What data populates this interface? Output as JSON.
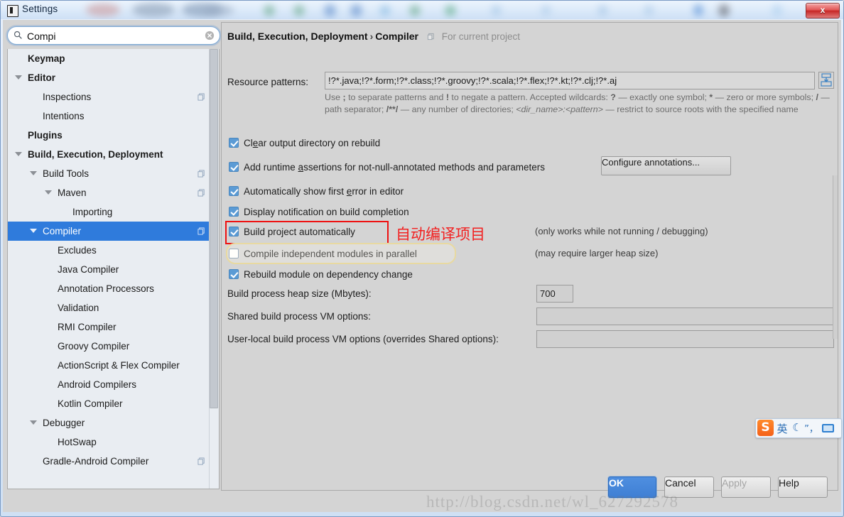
{
  "window": {
    "title": "Settings",
    "icon": "intellij-idea-icon",
    "close_label": "x"
  },
  "search": {
    "value": "Compi",
    "placeholder": "",
    "icon": "search-icon",
    "clear_icon": "clear-circle-icon"
  },
  "sidebar": {
    "items": [
      {
        "label": "Keymap",
        "indent": 0,
        "bold": true,
        "arrow": "none",
        "selected": false,
        "copy": false
      },
      {
        "label": "Editor",
        "indent": 0,
        "bold": true,
        "arrow": "expanded",
        "selected": false,
        "copy": false
      },
      {
        "label": "Inspections",
        "indent": 1,
        "bold": false,
        "arrow": "none",
        "selected": false,
        "copy": true
      },
      {
        "label": "Intentions",
        "indent": 1,
        "bold": false,
        "arrow": "none",
        "selected": false,
        "copy": false
      },
      {
        "label": "Plugins",
        "indent": 0,
        "bold": true,
        "arrow": "none",
        "selected": false,
        "copy": false
      },
      {
        "label": "Build, Execution, Deployment",
        "indent": 0,
        "bold": true,
        "arrow": "expanded",
        "selected": false,
        "copy": false
      },
      {
        "label": "Build Tools",
        "indent": 1,
        "bold": false,
        "arrow": "expanded",
        "selected": false,
        "copy": true
      },
      {
        "label": "Maven",
        "indent": 2,
        "bold": false,
        "arrow": "expanded",
        "selected": false,
        "copy": true
      },
      {
        "label": "Importing",
        "indent": 3,
        "bold": false,
        "arrow": "none",
        "selected": false,
        "copy": false
      },
      {
        "label": "Compiler",
        "indent": 1,
        "bold": false,
        "arrow": "expanded",
        "selected": true,
        "copy": true
      },
      {
        "label": "Excludes",
        "indent": 2,
        "bold": false,
        "arrow": "none",
        "selected": false,
        "copy": false
      },
      {
        "label": "Java Compiler",
        "indent": 2,
        "bold": false,
        "arrow": "none",
        "selected": false,
        "copy": false
      },
      {
        "label": "Annotation Processors",
        "indent": 2,
        "bold": false,
        "arrow": "none",
        "selected": false,
        "copy": false
      },
      {
        "label": "Validation",
        "indent": 2,
        "bold": false,
        "arrow": "none",
        "selected": false,
        "copy": false
      },
      {
        "label": "RMI Compiler",
        "indent": 2,
        "bold": false,
        "arrow": "none",
        "selected": false,
        "copy": false
      },
      {
        "label": "Groovy Compiler",
        "indent": 2,
        "bold": false,
        "arrow": "none",
        "selected": false,
        "copy": false
      },
      {
        "label": "ActionScript & Flex Compiler",
        "indent": 2,
        "bold": false,
        "arrow": "none",
        "selected": false,
        "copy": false
      },
      {
        "label": "Android Compilers",
        "indent": 2,
        "bold": false,
        "arrow": "none",
        "selected": false,
        "copy": false
      },
      {
        "label": "Kotlin Compiler",
        "indent": 2,
        "bold": false,
        "arrow": "none",
        "selected": false,
        "copy": false
      },
      {
        "label": "Debugger",
        "indent": 1,
        "bold": false,
        "arrow": "expanded",
        "selected": false,
        "copy": false
      },
      {
        "label": "HotSwap",
        "indent": 2,
        "bold": false,
        "arrow": "none",
        "selected": false,
        "copy": false
      },
      {
        "label": "Gradle-Android Compiler",
        "indent": 1,
        "bold": false,
        "arrow": "none",
        "selected": false,
        "copy": true
      }
    ]
  },
  "breadcrumb": {
    "part1": "Build, Execution, Deployment",
    "separator": "›",
    "part2": "Compiler",
    "scope": "For current project"
  },
  "form": {
    "resource_patterns_label": "Resource patterns:",
    "resource_patterns_value": "!?*.java;!?*.form;!?*.class;!?*.groovy;!?*.scala;!?*.flex;!?*.kt;!?*.clj;!?*.aj",
    "expand_button_icon": "expand-into-box-icon",
    "help_line1_a": "Use ",
    "help_line1_b": ";",
    "help_line1_c": " to separate patterns and ",
    "help_line1_d": "!",
    "help_line1_e": " to negate a pattern. Accepted wildcards: ",
    "help_line1_f": "?",
    "help_line1_g": " — exactly one symbol; ",
    "help_line1_h": "*",
    "help_line1_i": " — zero or more symbols; ",
    "help_line1_j": "/",
    "help_line1_k": " — path separator; ",
    "help_line1_l": "/**/",
    "help_line1_m": " — any number of directories; ",
    "help_line1_n": "<dir_name>:<pattern>",
    "help_line1_o": " — restrict to source roots with the specified name",
    "heap_label": "Build process heap size (Mbytes):",
    "heap_value": "700",
    "shared_vm_label": "Shared build process VM options:",
    "shared_vm_value": "",
    "userlocal_vm_label": "User-local build process VM options (overrides Shared options):",
    "userlocal_vm_value": ""
  },
  "checkboxes": [
    {
      "label_pre": "Cl",
      "mnemonic": "e",
      "label_post": "ar output directory on rebuild",
      "checked": true
    },
    {
      "label_pre": "Add runtime ",
      "mnemonic": "a",
      "label_post": "ssertions for not-null-annotated methods and parameters",
      "checked": true
    },
    {
      "label_pre": "Automatically show first ",
      "mnemonic": "e",
      "label_post": "rror in editor",
      "checked": true
    },
    {
      "label_pre": "Display notification on build completion",
      "mnemonic": "",
      "label_post": "",
      "checked": true
    },
    {
      "label_pre": "Build project automatically",
      "mnemonic": "",
      "label_post": "",
      "checked": true
    },
    {
      "label_pre": "Compile independent modules in parallel",
      "mnemonic": "",
      "label_post": "",
      "checked": false
    },
    {
      "label_pre": "Rebuild module on dependency change",
      "mnemonic": "",
      "label_post": "",
      "checked": true
    }
  ],
  "hints": {
    "not_running": "(only works while not running / debugging)",
    "heap_size": "(may require larger heap size)"
  },
  "buttons": {
    "configure_annotations": "Configure annotations...",
    "ok": "OK",
    "cancel": "Cancel",
    "apply": "Apply",
    "help": "Help"
  },
  "annotations": {
    "chinese_note": "自动编译项目",
    "highlight_color": "#ee1111",
    "focus_ring_color": "#e8d9a0"
  },
  "watermark": {
    "text": "http://blog.csdn.net/wl_627292578"
  },
  "ime": {
    "logo": "S",
    "mode": "英",
    "moon": "☾",
    "punctuation": "”，",
    "keyboard_icon": "keyboard-icon"
  }
}
